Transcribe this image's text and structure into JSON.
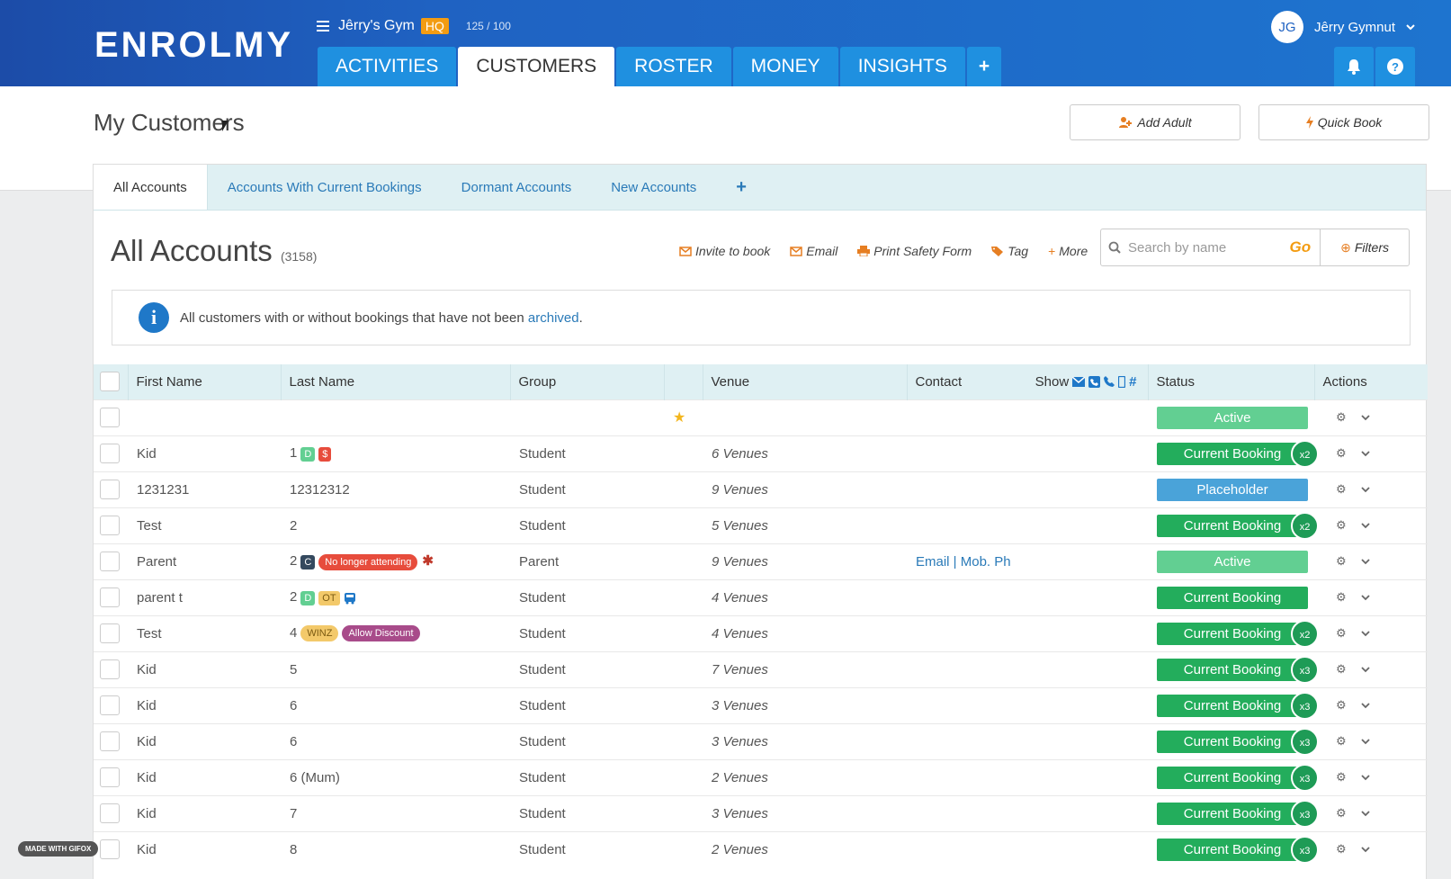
{
  "app": {
    "logo": "ENROLMY",
    "org_name": "Jêrry's Gym",
    "org_badge": "HQ",
    "usage": "125 / 100",
    "user_initials": "JG",
    "user_name": "Jêrry Gymnut"
  },
  "nav": {
    "tabs": [
      {
        "label": "ACTIVITIES"
      },
      {
        "label": "CUSTOMERS"
      },
      {
        "label": "ROSTER"
      },
      {
        "label": "MONEY"
      },
      {
        "label": "INSIGHTS"
      }
    ],
    "plus": "+"
  },
  "page": {
    "title": "My Customers",
    "add_adult": "Add Adult",
    "quick_book": "Quick Book"
  },
  "subtabs": [
    {
      "label": "All Accounts"
    },
    {
      "label": "Accounts With Current Bookings"
    },
    {
      "label": "Dormant Accounts"
    },
    {
      "label": "New Accounts"
    }
  ],
  "accounts": {
    "title": "All Accounts",
    "count": "(3158)",
    "actions": [
      "Invite to book",
      "Email",
      "Print Safety Form",
      "Tag",
      "More"
    ],
    "search_placeholder": "Search by name",
    "go": "Go",
    "filters": "Filters",
    "info_text": "All customers with or without bookings that have not been ",
    "info_link": "archived",
    "info_end": "."
  },
  "table": {
    "headers": {
      "first": "First Name",
      "last": "Last Name",
      "group": "Group",
      "venue": "Venue",
      "contact": "Contact",
      "show": "Show",
      "status": "Status",
      "actions": "Actions"
    },
    "rows": [
      {
        "first": "",
        "last": "",
        "group": "",
        "venue": "",
        "contact": "",
        "status": "Active",
        "multi": ""
      },
      {
        "first": "Kid",
        "last": "1",
        "group": "Student",
        "venue": "6 Venues",
        "contact": "",
        "status": "Current Booking",
        "multi": "x2"
      },
      {
        "first": "1231231",
        "last": "12312312",
        "group": "Student",
        "venue": "9 Venues",
        "contact": "",
        "status": "Placeholder",
        "multi": ""
      },
      {
        "first": "Test",
        "last": "2",
        "group": "Student",
        "venue": "5 Venues",
        "contact": "",
        "status": "Current Booking",
        "multi": "x2"
      },
      {
        "first": "Parent",
        "last": "2",
        "group": "Parent",
        "venue": "9 Venues",
        "contact": "Email | Mob. Ph",
        "status": "Active",
        "multi": ""
      },
      {
        "first": "parent t",
        "last": "2",
        "group": "Student",
        "venue": "4 Venues",
        "contact": "",
        "status": "Current Booking",
        "multi": ""
      },
      {
        "first": "Test",
        "last": "4",
        "group": "Student",
        "venue": "4 Venues",
        "contact": "",
        "status": "Current Booking",
        "multi": "x2"
      },
      {
        "first": "Kid",
        "last": "5",
        "group": "Student",
        "venue": "7 Venues",
        "contact": "",
        "status": "Current Booking",
        "multi": "x3"
      },
      {
        "first": "Kid",
        "last": "6",
        "group": "Student",
        "venue": "3 Venues",
        "contact": "",
        "status": "Current Booking",
        "multi": "x3"
      },
      {
        "first": "Kid",
        "last": "6",
        "group": "Student",
        "venue": "3 Venues",
        "contact": "",
        "status": "Current Booking",
        "multi": "x3"
      },
      {
        "first": "Kid",
        "last": "6 (Mum)",
        "group": "Student",
        "venue": "2 Venues",
        "contact": "",
        "status": "Current Booking",
        "multi": "x3"
      },
      {
        "first": "Kid",
        "last": "7",
        "group": "Student",
        "venue": "3 Venues",
        "contact": "",
        "status": "Current Booking",
        "multi": "x3"
      },
      {
        "first": "Kid",
        "last": "8",
        "group": "Student",
        "venue": "2 Venues",
        "contact": "",
        "status": "Current Booking",
        "multi": "x3"
      }
    ],
    "tags": {
      "d": "D",
      "dollar": "$",
      "c": "C",
      "no_longer": "No longer attending",
      "ot": "OT",
      "winz": "WINZ",
      "allow_discount": "Allow Discount"
    }
  },
  "watermark": "MADE WITH GIFOX",
  "colors": {
    "active": "#62cf92",
    "current_booking": "#23ad5c",
    "placeholder": "#4aa3d9",
    "multi": "#1e9b56",
    "accent": "#1f90e0"
  }
}
